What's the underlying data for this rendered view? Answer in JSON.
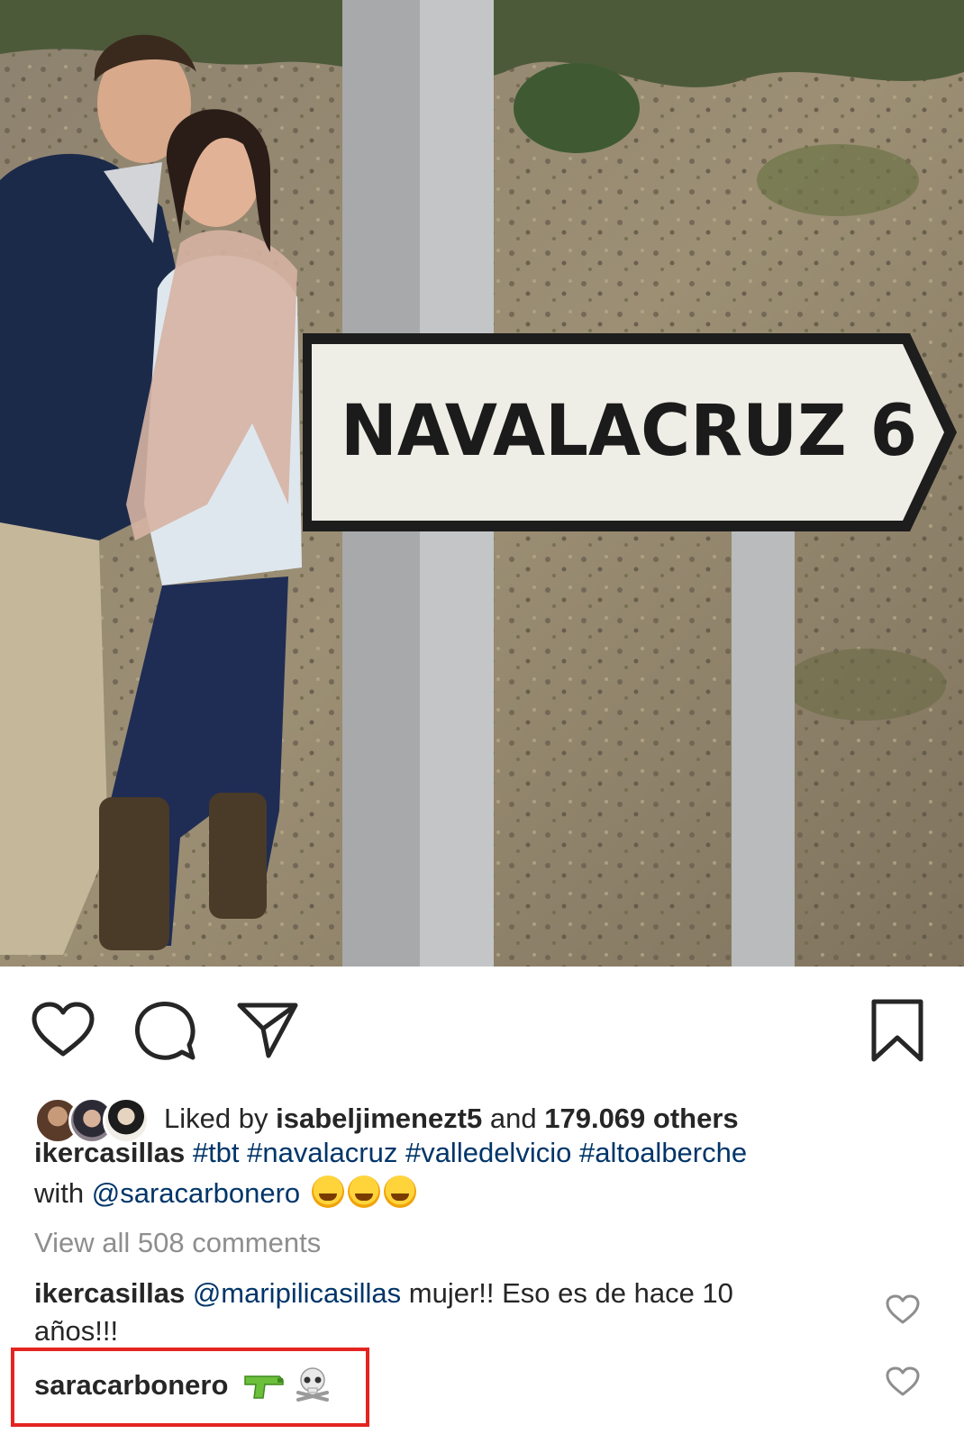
{
  "photo": {
    "sign_text": "NAVALACRUZ 6"
  },
  "actions": {
    "like": "heart-icon",
    "comment": "comment-icon",
    "share": "share-icon",
    "save": "bookmark-icon"
  },
  "likes": {
    "prefix": "Liked by",
    "user": "isabeljimenezt5",
    "middle": "and",
    "count": "179.069 others"
  },
  "caption": {
    "username": "ikercasillas",
    "hashtags": [
      "#tbt",
      "#navalacruz",
      "#valledelvicio",
      "#altoalberche"
    ],
    "with_text": "with",
    "mention": "@saracarbonero",
    "emojis": [
      "rolling-laughing-emoji",
      "tears-of-joy-emoji",
      "sweat-smile-emoji"
    ]
  },
  "view_all_comments": "View all 508 comments",
  "comments": [
    {
      "username": "ikercasillas",
      "mention": "@maripilicasillas",
      "text_line1": "mujer!! Eso es de hace 10",
      "text_line2": "años!!!"
    },
    {
      "username": "saracarbonero",
      "emojis": [
        "water-pistol-emoji",
        "skull-and-crossbones-emoji"
      ]
    }
  ],
  "colors": {
    "link": "#003569",
    "muted": "#8e8e8e",
    "highlight": "#e52420"
  }
}
